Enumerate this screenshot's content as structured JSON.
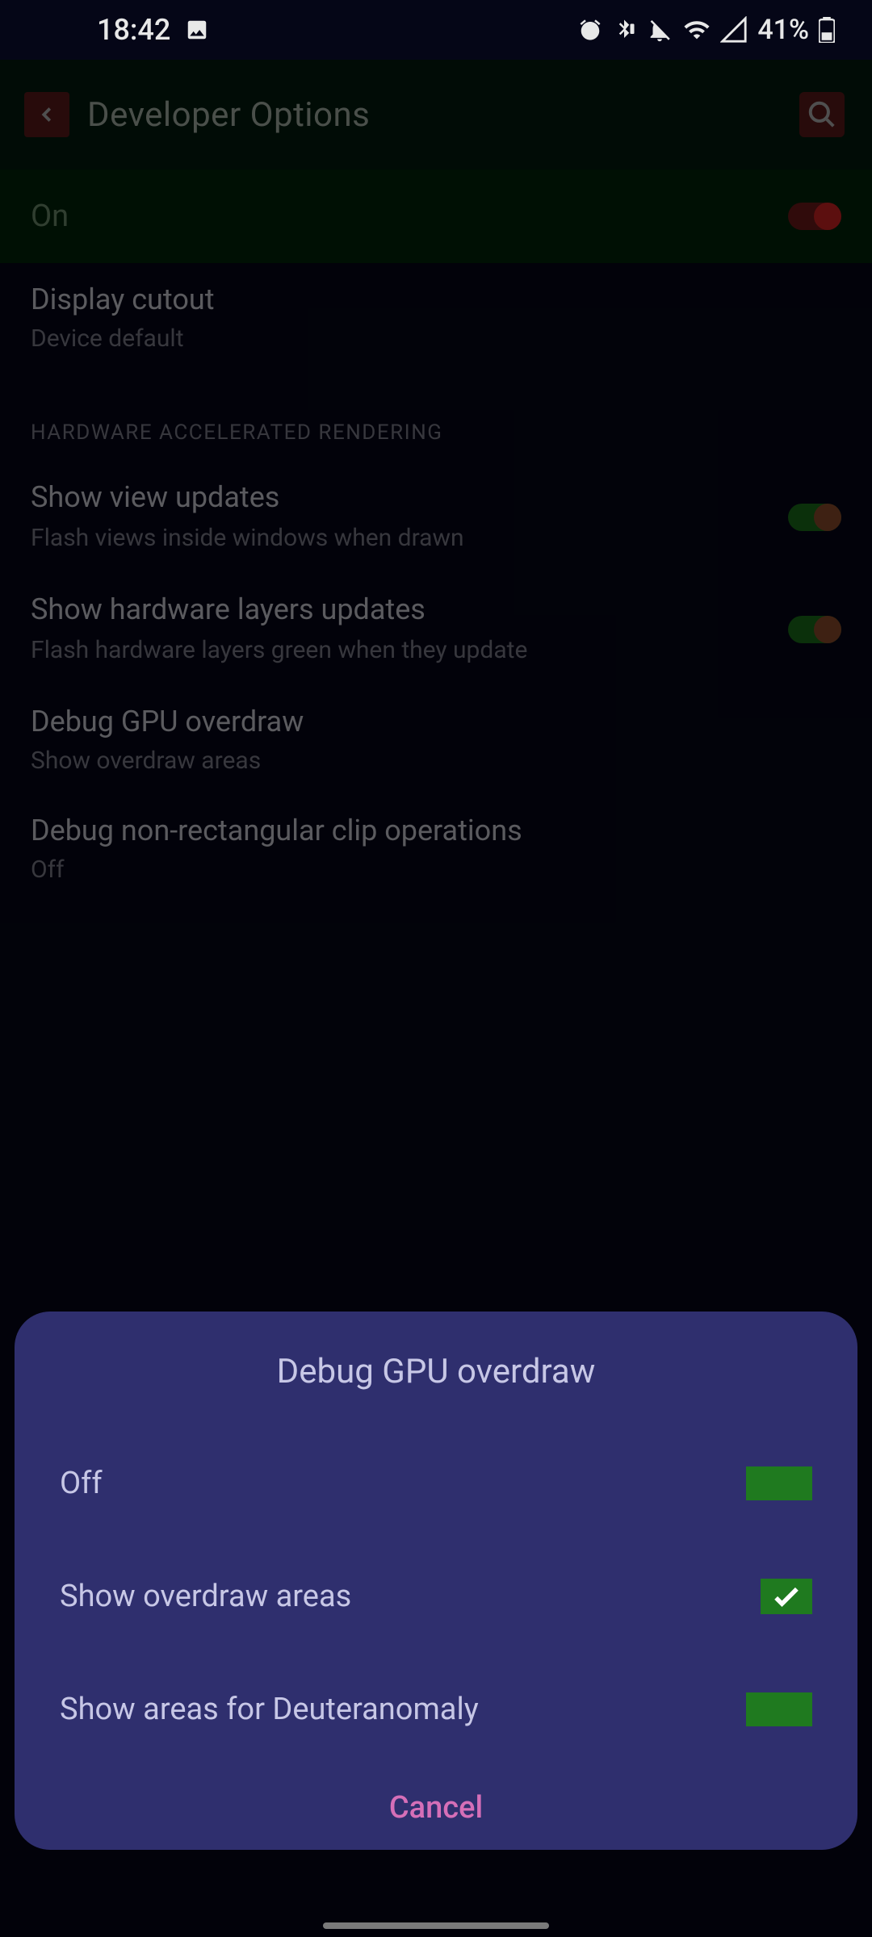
{
  "statusbar": {
    "time": "18:42",
    "battery_pct": "41%"
  },
  "appbar": {
    "title": "Developer Options"
  },
  "master": {
    "label": "On"
  },
  "settings": {
    "display_cutout": {
      "title": "Display cutout",
      "sub": "Device default"
    },
    "section_hw": "HARDWARE ACCELERATED RENDERING",
    "show_view_updates": {
      "title": "Show view updates",
      "sub": "Flash views inside windows when drawn"
    },
    "show_hw_layers": {
      "title": "Show hardware layers updates",
      "sub": "Flash hardware layers green when they update"
    },
    "debug_gpu_overdraw": {
      "title": "Debug GPU overdraw",
      "sub": "Show overdraw areas"
    },
    "debug_clip": {
      "title": "Debug non-rectangular clip operations",
      "sub": "Off"
    }
  },
  "dialog": {
    "title": "Debug GPU overdraw",
    "options": [
      {
        "label": "Off",
        "checked": false
      },
      {
        "label": "Show overdraw areas",
        "checked": true
      },
      {
        "label": "Show areas for Deuteranomaly",
        "checked": false
      }
    ],
    "cancel": "Cancel"
  }
}
